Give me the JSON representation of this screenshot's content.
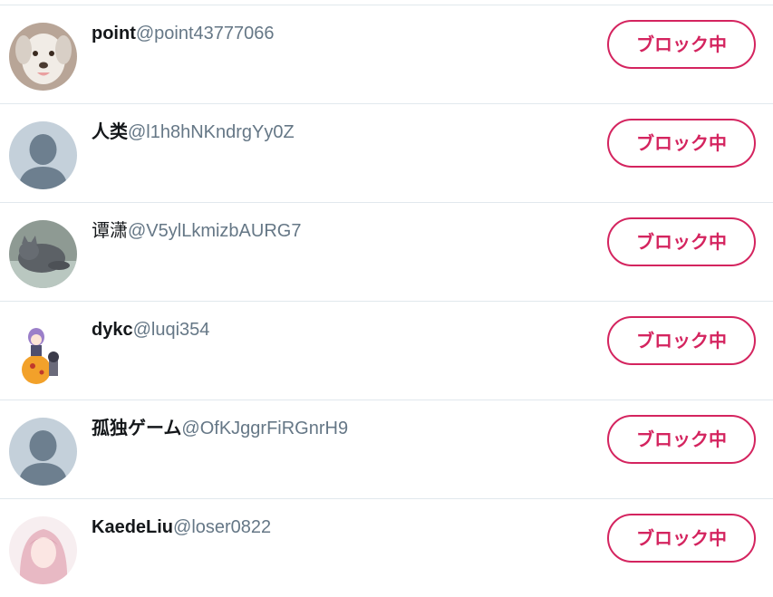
{
  "blocked_users": [
    {
      "display_name": "point",
      "handle": "@point43777066",
      "avatar": "dog-photo",
      "button_label": "ブロック中"
    },
    {
      "display_name": "人类",
      "handle": "@l1h8hNKndrgYy0Z",
      "avatar": "default-profile",
      "button_label": "ブロック中"
    },
    {
      "display_name": "谭潇",
      "handle": "@V5ylLkmizbAURG7",
      "avatar": "cat-photo",
      "button_label": "ブロック中"
    },
    {
      "display_name": "dykc",
      "handle": "@luqi354",
      "avatar": "anime-character",
      "button_label": "ブロック中"
    },
    {
      "display_name": "孤独ゲーム",
      "handle": "@OfKJggrFiRGnrH9",
      "avatar": "default-profile",
      "button_label": "ブロック中"
    },
    {
      "display_name": "KaedeLiu",
      "handle": "@loser0822",
      "avatar": "anime-girl",
      "button_label": "ブロック中"
    }
  ],
  "colors": {
    "accent": "#d4245f",
    "handle": "#657786",
    "name": "#14171a",
    "divider": "#e1e8ed",
    "default_avatar_bg": "#c4d0da",
    "default_avatar_fg": "#6d7f8f"
  }
}
